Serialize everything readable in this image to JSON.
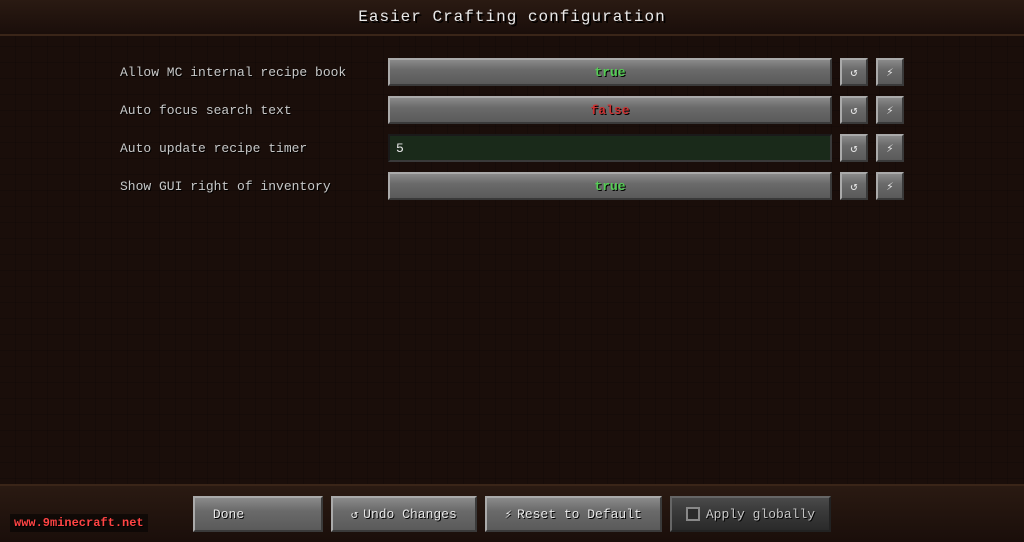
{
  "title": "Easier Crafting configuration",
  "rows": [
    {
      "id": "allow-mc-internal-recipe-book",
      "label": "Allow MC internal recipe book",
      "type": "toggle",
      "value": "true",
      "valueClass": "true-val"
    },
    {
      "id": "auto-focus-search-text",
      "label": "Auto focus search text",
      "type": "toggle",
      "value": "false",
      "valueClass": "false-val"
    },
    {
      "id": "auto-update-recipe-timer",
      "label": "Auto update recipe timer",
      "type": "input",
      "value": "5"
    },
    {
      "id": "show-gui-right-of-inventory",
      "label": "Show GUI right of inventory",
      "type": "toggle",
      "value": "true",
      "valueClass": "true-val"
    }
  ],
  "footer": {
    "done_label": "Done",
    "undo_label": "Undo Changes",
    "reset_label": "Reset to Default",
    "apply_label": "Apply globally",
    "undo_icon": "↺",
    "reset_icon": "⚡"
  },
  "watermark": "www.9minecraft.net"
}
